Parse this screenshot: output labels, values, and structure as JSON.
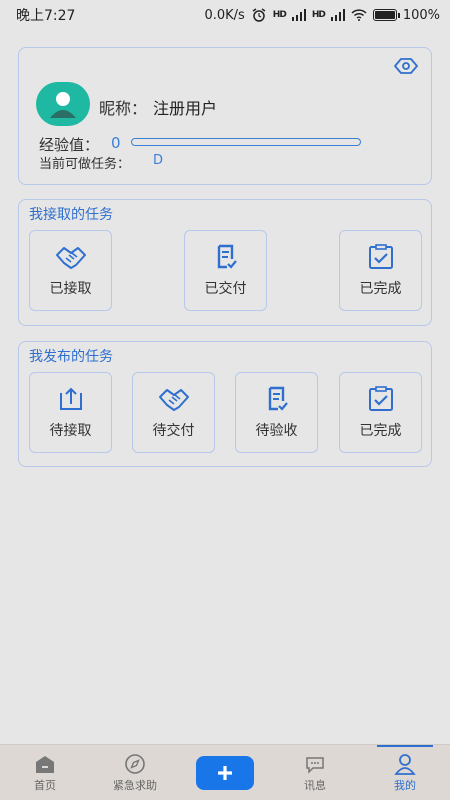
{
  "status_bar": {
    "time": "晚上7:27",
    "network_speed": "0.0K/s",
    "signal1": "HD",
    "signal2": "HD",
    "battery": "100%"
  },
  "profile": {
    "nickname_label": "昵称：",
    "nickname": "注册用户",
    "exp_label": "经验值：",
    "exp_value": "0",
    "exp_progress": 0,
    "task_level_label": "当前可做任务：",
    "task_level": "D"
  },
  "received_tasks": {
    "title": "我接取的任务",
    "items": [
      {
        "label": "已接取",
        "icon": "handshake-icon"
      },
      {
        "label": "已交付",
        "icon": "document-check-icon"
      },
      {
        "label": "已完成",
        "icon": "clipboard-check-icon"
      }
    ]
  },
  "published_tasks": {
    "title": "我发布的任务",
    "items": [
      {
        "label": "待接取",
        "icon": "upload-icon"
      },
      {
        "label": "待交付",
        "icon": "handshake-icon"
      },
      {
        "label": "待验收",
        "icon": "document-check-icon"
      },
      {
        "label": "已完成",
        "icon": "clipboard-check-icon"
      }
    ]
  },
  "bottom_nav": {
    "items": [
      {
        "label": "首页",
        "icon": "home-icon"
      },
      {
        "label": "紧急求助",
        "icon": "compass-icon"
      },
      {
        "label": "",
        "icon": "plus-icon"
      },
      {
        "label": "讯息",
        "icon": "chat-icon"
      },
      {
        "label": "我的",
        "icon": "user-icon"
      }
    ],
    "active": "我的"
  },
  "colors": {
    "accent": "#2f6fcf",
    "avatar": "#1fb8a2",
    "add_button": "#1976e8"
  }
}
